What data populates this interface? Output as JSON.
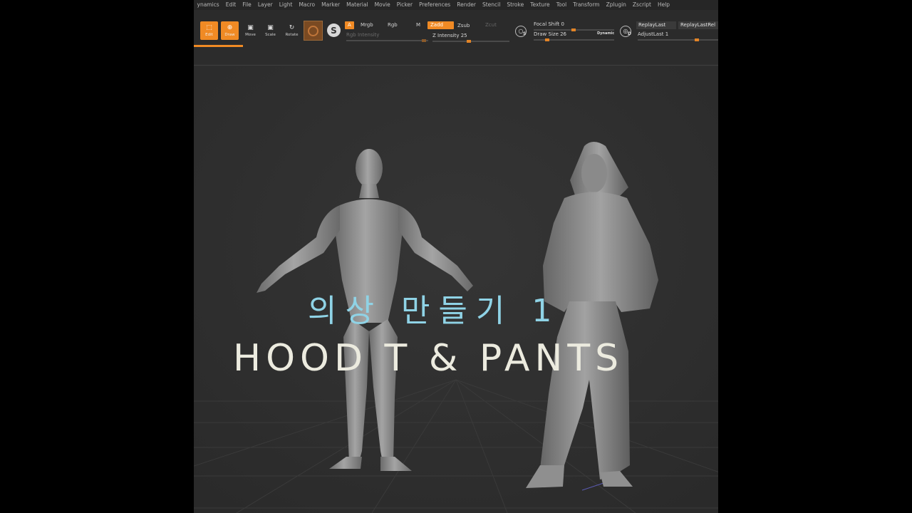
{
  "menu": [
    "ynamics",
    "Edit",
    "File",
    "Layer",
    "Light",
    "Macro",
    "Marker",
    "Material",
    "Movie",
    "Picker",
    "Preferences",
    "Render",
    "Stencil",
    "Stroke",
    "Texture",
    "Tool",
    "Transform",
    "Zplugin",
    "Zscript",
    "Help"
  ],
  "tools": {
    "edit": "Edit",
    "draw": "Draw",
    "move": "Move",
    "scale": "Scale",
    "rotate": "Rotate"
  },
  "color_modes": {
    "a": "A",
    "mrgb": "Mrgb",
    "rgb": "Rgb",
    "m": "M"
  },
  "depth_modes": {
    "zadd": "Zadd",
    "zsub": "Zsub",
    "zcut": "Zcut"
  },
  "sliders": {
    "rgb_intensity": "Rgb Intensity",
    "z_intensity": "Z Intensity 25",
    "focal_shift": "Focal Shift 0",
    "draw_size": "Draw Size 26",
    "adjust_last": "AdjustLast 1"
  },
  "dynamic_label": "Dynamic",
  "replay": {
    "replay_last": "ReplayLast",
    "replay_last_rel": "ReplayLastRel"
  },
  "round_icons": {
    "s_label": "S",
    "d_label": "D"
  },
  "overlay": {
    "title_ko": "의상 만들기 1",
    "title_en": "HOOD T & PANTS"
  },
  "colors": {
    "accent": "#f08a24",
    "title_ko": "#8fd3e6",
    "title_en": "#ecebdf",
    "viewport": "#2f2f2f"
  }
}
